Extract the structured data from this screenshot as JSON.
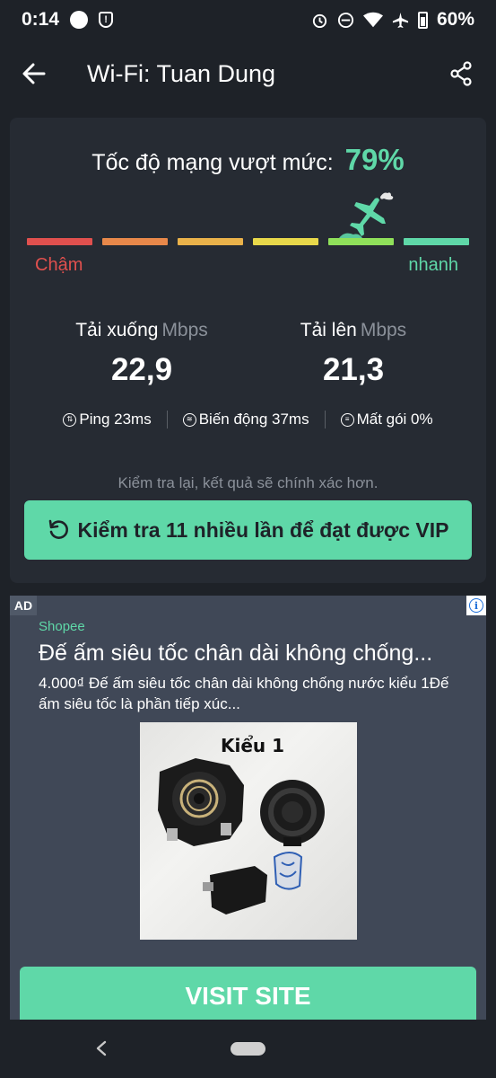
{
  "status_bar": {
    "time": "0:14",
    "icons": [
      "circle-icon",
      "shield-alert-icon",
      "alarm-icon",
      "dnd-icon",
      "wifi-icon",
      "airplane-icon",
      "battery-icon"
    ],
    "battery": "60%"
  },
  "app_bar": {
    "title": "Wi-Fi: Tuan Dung"
  },
  "result": {
    "exceed_label": "Tốc độ mạng vượt mức:",
    "exceed_percent": "79%",
    "scale_colors": [
      "#e0504e",
      "#e8884a",
      "#eab24a",
      "#e8d84a",
      "#8fe05a",
      "#5fd8a8"
    ],
    "scale_active_index": 4,
    "slow_label": "Chậm",
    "fast_label": "nhanh",
    "download": {
      "label": "Tải xuống",
      "unit": "Mbps",
      "value": "22,9"
    },
    "upload": {
      "label": "Tải lên",
      "unit": "Mbps",
      "value": "21,3"
    },
    "stats": [
      {
        "icon": "ping-icon",
        "text": "Ping 23ms"
      },
      {
        "icon": "jitter-icon",
        "text": "Biến động 37ms"
      },
      {
        "icon": "packet-loss-icon",
        "text": "Mất gói 0%"
      }
    ],
    "retest_note": "Kiểm tra lại, kết quả sẽ chính xác hơn.",
    "vip_button": "Kiểm tra 11 nhiều lần để đạt được VIP"
  },
  "ad": {
    "badge": "AD",
    "advertiser": "Shopee",
    "headline": "Đế ấm siêu tốc chân dài không chống...",
    "body": "4.000₫ Đế ấm siêu tốc chân dài không chống nước kiểu 1Đế ấm siêu tốc là phần tiếp xúc...",
    "image_caption": "Kiểu 1",
    "cta": "VISIT SITE"
  },
  "colors": {
    "accent": "#5fd8a8",
    "background": "#1e2228",
    "card": "#262b33",
    "slow": "#e0504e"
  }
}
